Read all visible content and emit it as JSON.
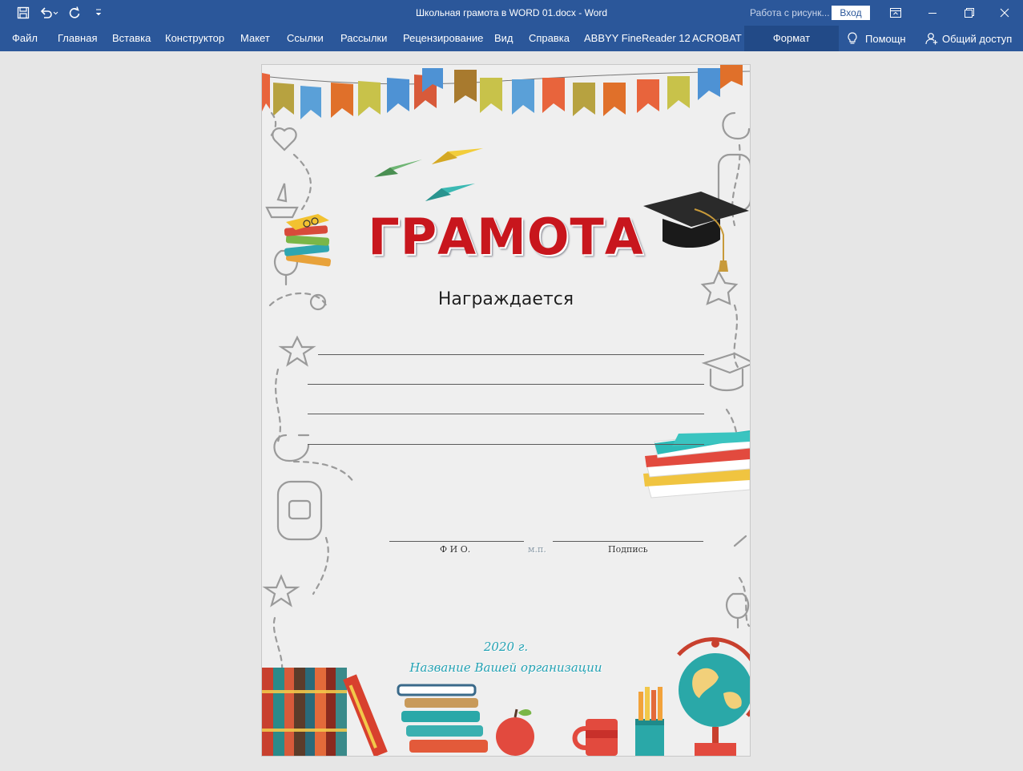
{
  "window": {
    "title": "Школьная грамота в WORD 01.docx  -  Word",
    "context_label": "Работа с рисунк...",
    "signin_label": "Вход"
  },
  "ribbon": {
    "tabs": [
      {
        "label": "Файл"
      },
      {
        "label": "Главная"
      },
      {
        "label": "Вставка"
      },
      {
        "label": "Конструктор"
      },
      {
        "label": "Макет"
      },
      {
        "label": "Ссылки"
      },
      {
        "label": "Рассылки"
      },
      {
        "label": "Рецензирование"
      },
      {
        "label": "Вид"
      },
      {
        "label": "Справка"
      },
      {
        "label": "ABBYY FineReader 12"
      },
      {
        "label": "ACROBAT"
      }
    ],
    "context_tab": "Формат",
    "tell_me": "Помощн",
    "share": "Общий доступ"
  },
  "document": {
    "title": "ГРАМОТА",
    "subtitle": "Награждается",
    "signature": {
      "name_label": "Ф И О.",
      "stamp_label": "м.п.",
      "sign_label": "Подпись"
    },
    "year": "2020 г.",
    "organization": "Название Вашей организации"
  },
  "colors": {
    "accent": "#2b579a",
    "title_red": "#c8161d",
    "teal_text": "#23a2b4"
  }
}
